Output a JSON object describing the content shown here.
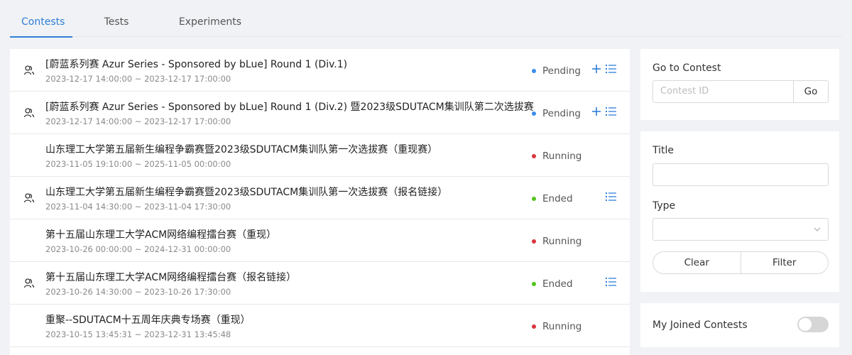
{
  "tabs": [
    "Contests",
    "Tests",
    "Experiments"
  ],
  "colors": {
    "accent": "#2f7fd8",
    "pending": "#3b8ef0",
    "running": "#d9363e",
    "ended": "#52c41a"
  },
  "contests": [
    {
      "title": "[蔚蓝系列赛 Azur Series - Sponsored by bLue] Round 1 (Div.1)",
      "time": "2023-12-17 14:00:00 ~ 2023-12-17 17:00:00",
      "status": "Pending",
      "private": true,
      "actions": [
        "plus-icon",
        "list-icon"
      ]
    },
    {
      "title": "[蔚蓝系列赛 Azur Series - Sponsored by bLue] Round 1 (Div.2) 暨2023级SDUTACM集训队第二次选拔赛",
      "time": "2023-12-17 14:00:00 ~ 2023-12-17 17:00:00",
      "status": "Pending",
      "private": true,
      "actions": [
        "plus-icon",
        "list-icon"
      ]
    },
    {
      "title": "山东理工大学第五届新生编程争霸赛暨2023级SDUTACM集训队第一次选拔赛（重现赛）",
      "time": "2023-11-05 19:10:00 ~ 2025-11-05 00:00:00",
      "status": "Running",
      "private": false,
      "actions": []
    },
    {
      "title": "山东理工大学第五届新生编程争霸赛暨2023级SDUTACM集训队第一次选拔赛（报名链接）",
      "time": "2023-11-04 14:30:00 ~ 2023-11-04 17:30:00",
      "status": "Ended",
      "private": true,
      "actions": [
        "list-icon"
      ]
    },
    {
      "title": "第十五届山东理工大学ACM网络编程擂台赛（重现）",
      "time": "2023-10-26 00:00:00 ~ 2024-12-31 00:00:00",
      "status": "Running",
      "private": false,
      "actions": []
    },
    {
      "title": "第十五届山东理工大学ACM网络编程擂台赛（报名链接）",
      "time": "2023-10-26 14:30:00 ~ 2023-10-26 17:30:00",
      "status": "Ended",
      "private": true,
      "actions": [
        "list-icon"
      ]
    },
    {
      "title": "重聚--SDUTACM十五周年庆典专场赛（重现）",
      "time": "2023-10-15 13:45:31 ~ 2023-12-31 13:45:48",
      "status": "Running",
      "private": false,
      "actions": []
    }
  ],
  "goto": {
    "label": "Go to Contest",
    "placeholder": "Contest ID",
    "button": "Go"
  },
  "filter": {
    "title_label": "Title",
    "title_value": "",
    "type_label": "Type",
    "type_value": "",
    "clear": "Clear",
    "filter": "Filter"
  },
  "joined": {
    "label": "My Joined Contests",
    "on": false
  }
}
